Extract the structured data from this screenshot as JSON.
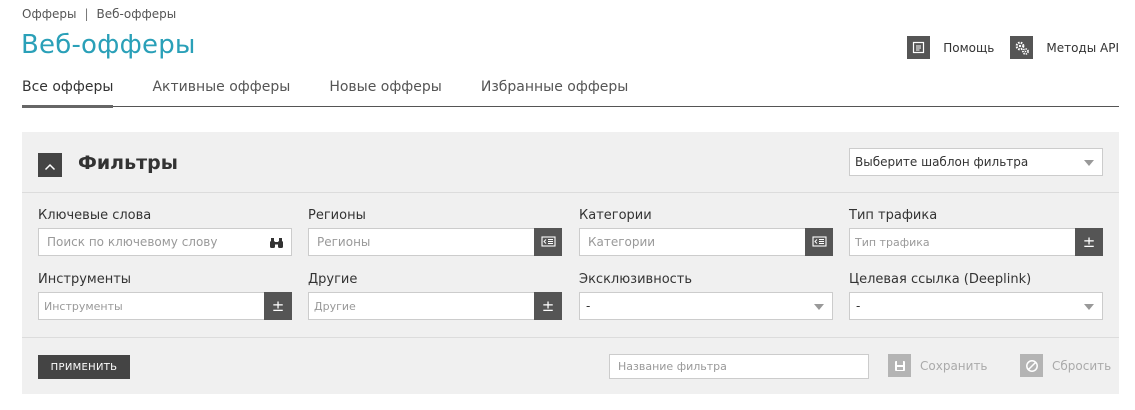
{
  "breadcrumb": {
    "items": [
      "Офферы",
      "Веб-офферы"
    ],
    "separator": "|"
  },
  "page": {
    "title": "Веб-офферы"
  },
  "header_actions": {
    "help": "Помощь",
    "api": "Методы API"
  },
  "tabs": [
    "Все офферы",
    "Активные офферы",
    "Новые офферы",
    "Избранные офферы"
  ],
  "active_tab": "Все офферы",
  "filters": {
    "title": "Фильтры",
    "template_select": "Выберите шаблон фильтра",
    "fields": {
      "keywords": {
        "label": "Ключевые слова",
        "placeholder": "Поиск по ключевому слову"
      },
      "regions": {
        "label": "Регионы",
        "placeholder": "Регионы"
      },
      "categories": {
        "label": "Категории",
        "placeholder": "Категории"
      },
      "traffic": {
        "label": "Тип трафика",
        "placeholder": "Тип трафика"
      },
      "tools": {
        "label": "Инструменты",
        "placeholder": "Инструменты"
      },
      "other": {
        "label": "Другие",
        "placeholder": "Другие"
      },
      "exclusivity": {
        "label": "Эксклюзивность",
        "value": "-"
      },
      "deeplink": {
        "label": "Целевая ссылка (Deeplink)",
        "value": "-"
      }
    },
    "plus_minus_glyph": "±",
    "apply_label": "ПРИМЕНИТЬ",
    "filter_name_placeholder": "Название фильтра",
    "save_label": "Сохранить",
    "reset_label": "Сбросить"
  },
  "colors": {
    "accent": "#2aa0b8",
    "dark_button": "#444444",
    "panel_bg": "#f0f0f0",
    "disabled": "#b4b4b4"
  },
  "icons": {
    "help": "document-icon",
    "api": "gears-icon",
    "collapse": "chevron-up-icon",
    "keywords": "binoculars-icon",
    "list": "list-icon",
    "save": "floppy-icon",
    "reset": "cancel-circle-icon"
  }
}
